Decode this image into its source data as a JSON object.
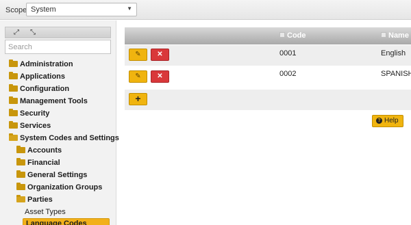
{
  "scope": {
    "label": "Scope",
    "selected": "System"
  },
  "tree_tools": {
    "expand_icon": "⤢",
    "collapse_icon": "⤡"
  },
  "search": {
    "placeholder": "Search"
  },
  "tree": {
    "administration": "Administration",
    "applications": "Applications",
    "configuration": "Configuration",
    "management_tools": "Management Tools",
    "security": "Security",
    "services": "Services",
    "system_codes": "System Codes and Settings",
    "accounts": "Accounts",
    "financial": "Financial",
    "general_settings": "General Settings",
    "organization_groups": "Organization Groups",
    "parties": "Parties",
    "asset_types": "Asset Types",
    "language_codes": "Language Codes"
  },
  "table": {
    "columns": {
      "code": "Code",
      "name": "Name"
    },
    "rows": [
      {
        "code": "0001",
        "name": "English"
      },
      {
        "code": "0002",
        "name": "SPANISH"
      }
    ]
  },
  "buttons": {
    "add": "+",
    "help": "Help"
  },
  "colors": {
    "accent": "#f0b40f",
    "danger": "#d9383a",
    "selected": "#f2b01a"
  }
}
